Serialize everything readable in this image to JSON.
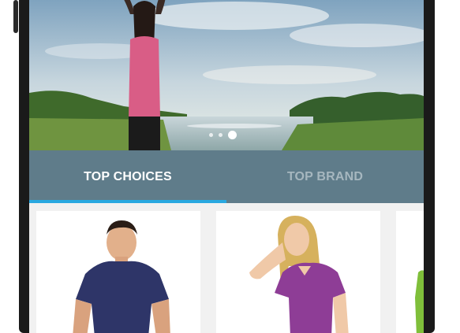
{
  "tabs": [
    {
      "label": "TOP CHOICES",
      "active": true
    },
    {
      "label": "TOP BRAND",
      "active": false
    }
  ],
  "carousel": {
    "total": 3,
    "active_index": 2
  },
  "products": [
    {
      "name": "man-navy-tshirt",
      "shirt_color": "#2e3568"
    },
    {
      "name": "woman-purple-tshirt",
      "shirt_color": "#8e3d96"
    },
    {
      "name": "partial-green-product",
      "shirt_color": "#7fbf3a"
    }
  ],
  "colors": {
    "tabbar": "#5f7c8a",
    "tab_indicator": "#29a8e0",
    "active_tab_text": "#ffffff",
    "inactive_tab_text": "#a6b7bf"
  }
}
